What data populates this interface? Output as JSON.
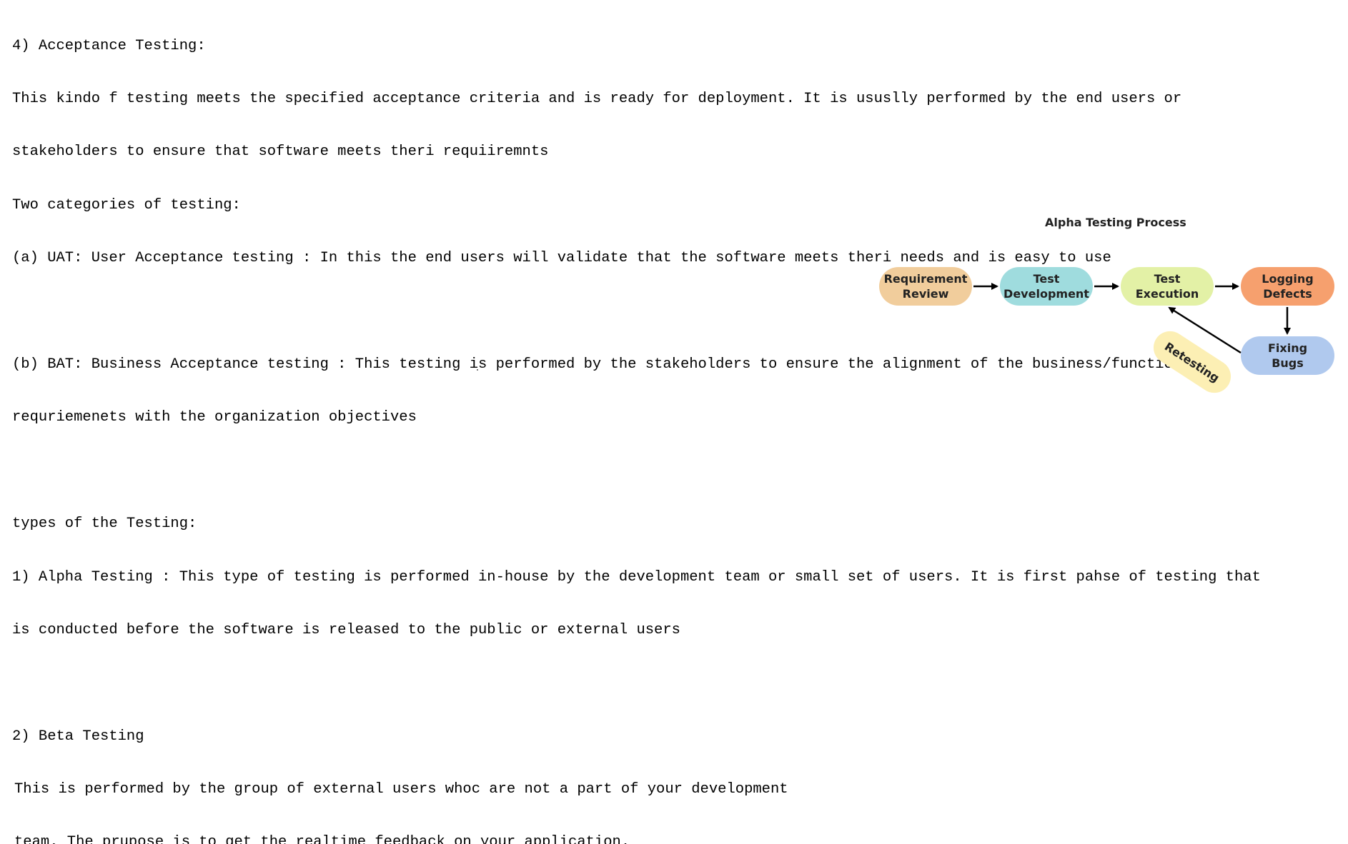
{
  "document": {
    "lines": [
      "4) Acceptance Testing:",
      "This kindo f testing meets the specified acceptance criteria and is ready for deployment. It is ususlly performed by the end users or",
      "stakeholders to ensure that software meets theri requiiremnts",
      "Two categories of testing:",
      "(a) UAT: User Acceptance testing : In this the end users will validate that the software meets theri needs and is easy to use",
      "",
      "(b) BAT: Business Acceptance testing : This testing is performed by the stakeholders to ensure the alignment of the business/functional",
      "requriemenets with the organization objectives",
      "",
      "types of the Testing:",
      "1) Alpha Testing : This type of testing is performed in-house by the development team or small set of users. It is first pahse of testing that",
      "is conducted before the software is released to the public or external users",
      "",
      "2) Beta Testing",
      "This is performed by the group of external users whoc are not a part of your development",
      "team. The prupose is to get the realtime feedback on your application."
    ]
  },
  "diagram": {
    "title": "Alpha Testing Process",
    "nodes": {
      "requirement_review": "Requirement\nReview",
      "test_development": "Test\nDevelopment",
      "test_execution": "Test\nExecution",
      "logging_defects": "Logging\nDefects",
      "fixing_bugs": "Fixing\nBugs"
    },
    "retesting_label": "Retesting",
    "colors": {
      "requirement_review": "#f1cd9c",
      "test_development": "#9fdcde",
      "test_execution": "#e3f1a6",
      "logging_defects": "#f6a06e",
      "fixing_bugs": "#b0c9ee",
      "retesting": "#fcefb4",
      "arrow": "#000000"
    }
  }
}
